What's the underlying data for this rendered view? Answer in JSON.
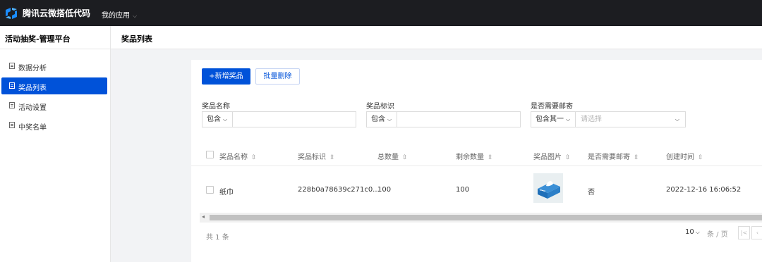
{
  "topbar": {
    "brand_name": "腾讯云微搭低代码",
    "app_menu_label": "我的应用",
    "colors": {
      "bar": "#1c1d21",
      "logo": "#1a8cff"
    }
  },
  "sidebar": {
    "platform_title": "活动抽奖-管理平台",
    "items": [
      {
        "label": "数据分析",
        "icon": "list-icon",
        "active": false
      },
      {
        "label": "奖品列表",
        "icon": "list-icon",
        "active": true
      },
      {
        "label": "活动设置",
        "icon": "list-icon",
        "active": false
      },
      {
        "label": "中奖名单",
        "icon": "list-icon",
        "active": false
      }
    ],
    "active_color": "#0052d9"
  },
  "page": {
    "title": "奖品列表"
  },
  "toolbar": {
    "add_label": "+新增奖品",
    "batch_delete_label": "批量删除"
  },
  "filters": {
    "name": {
      "label": "奖品名称",
      "operator": "包含",
      "value": ""
    },
    "tag": {
      "label": "奖品标识",
      "operator": "包含",
      "value": ""
    },
    "mail": {
      "label": "是否需要邮寄",
      "operator": "包含其一",
      "placeholder": "请选择"
    }
  },
  "table": {
    "columns": [
      "奖品名称",
      "奖品标识",
      "总数量",
      "剩余数量",
      "奖品图片",
      "是否需要邮寄",
      "创建时间"
    ],
    "rows": [
      {
        "name": "纸巾",
        "tag": "228b0a78639c271c0...",
        "total": "100",
        "remaining": "100",
        "image": "tissue-box-image",
        "needs_mail": "否",
        "created": "2022-12-16 16:06:52"
      }
    ]
  },
  "pagination": {
    "total_text": "共 1 条",
    "page_size": "10",
    "per_page_text": "条 / 页",
    "first_icon": "first-page-icon",
    "prev_icon": "prev-page-icon"
  }
}
